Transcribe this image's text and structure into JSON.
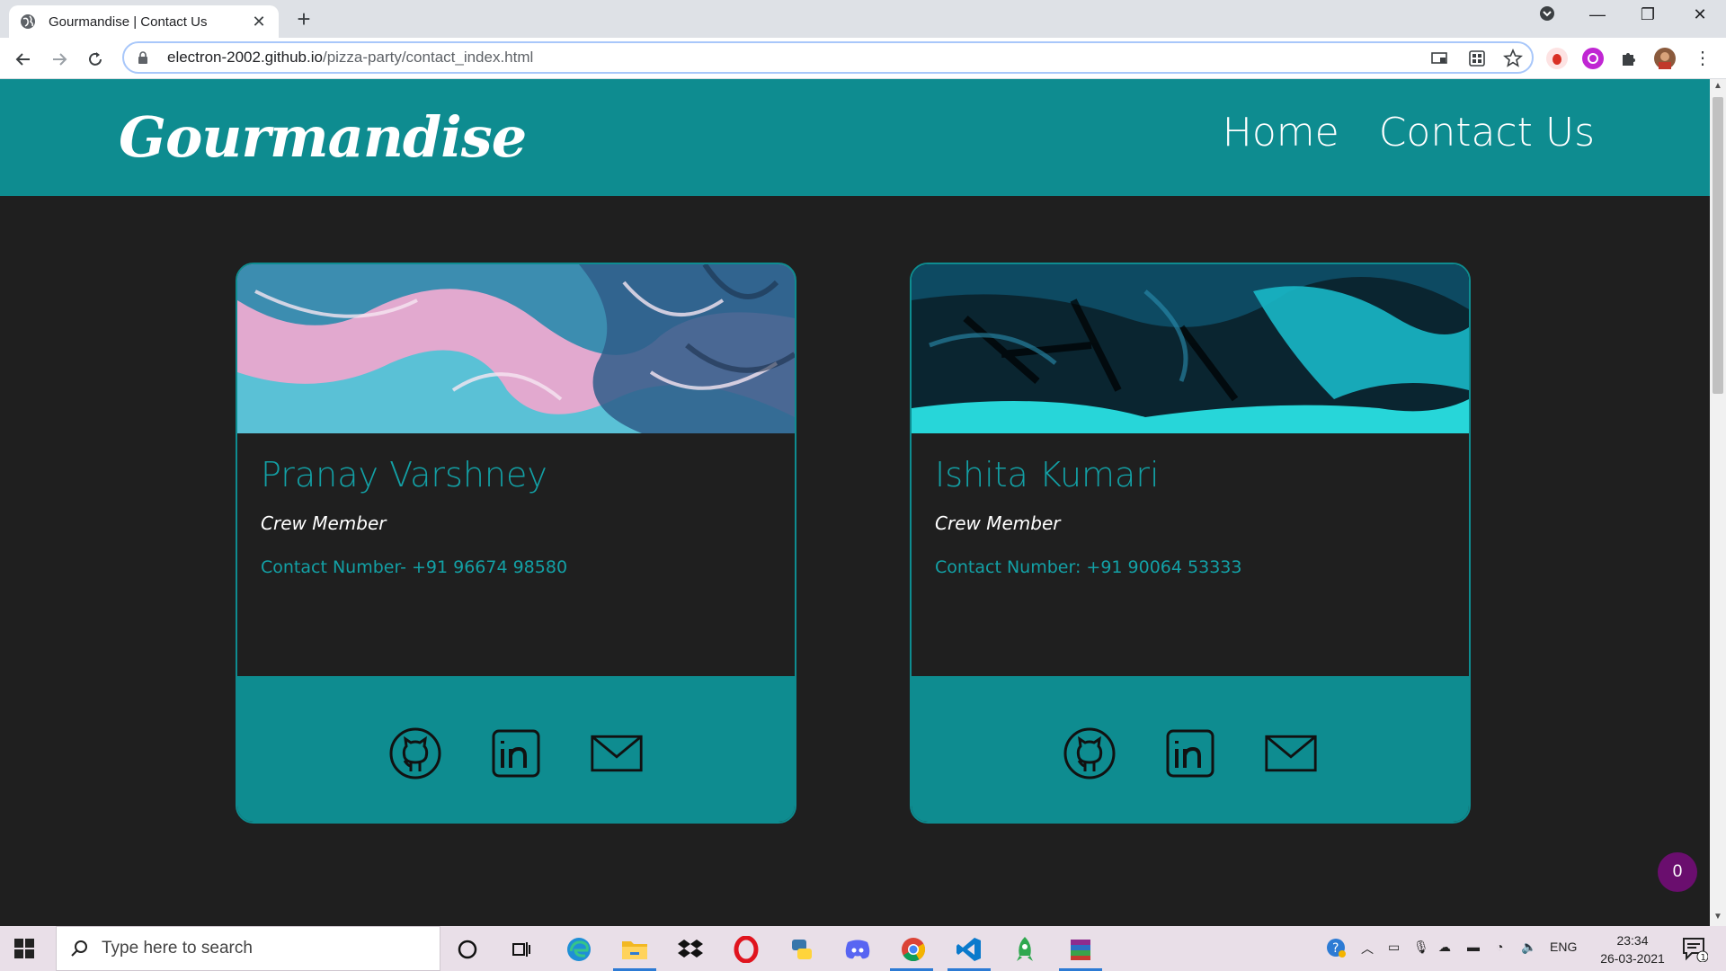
{
  "browser": {
    "tab_title": "Gourmandise | Contact Us",
    "url_domain": "electron-2002.github.io",
    "url_path": "/pizza-party/contact_index.html"
  },
  "site": {
    "brand": "Gourmandise",
    "nav": [
      "Home",
      "Contact Us"
    ]
  },
  "cards": [
    {
      "name": "Pranay Varshney",
      "role": "Crew Member",
      "contact": "Contact Number- +91 96674 98580",
      "cover": "pink-blue-marble-art"
    },
    {
      "name": "Ishita Kumari",
      "role": "Crew Member",
      "contact": "Contact Number: +91 90064 53333",
      "cover": "teal-black-brush-art"
    }
  ],
  "cart_count": "0",
  "taskbar": {
    "search_placeholder": "Type here to search",
    "language": "ENG",
    "time": "23:34",
    "date": "26-03-2021",
    "notifications": "1"
  },
  "colors": {
    "accent": "#0e8c90",
    "accent_text": "#13a0a5",
    "page_bg": "#1f1f1f",
    "badge": "#6a0e6e"
  }
}
